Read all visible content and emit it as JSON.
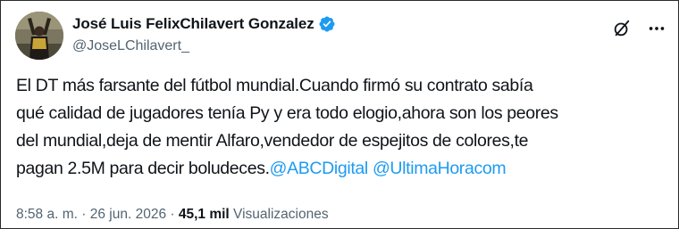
{
  "author": {
    "display_name": "José Luis FelixChilavert Gonzalez",
    "handle": "@JoseLChilavert_",
    "verified": true,
    "avatar_icon": "player-photo-avatar"
  },
  "header_actions": {
    "grok_icon": "grok-slash-circle-icon",
    "more_icon": "more-horizontal-icon"
  },
  "tweet": {
    "lines": [
      "El DT más farsante del fútbol mundial.Cuando firmó su contrato sabía",
      "qué calidad de jugadores tenía Py y era todo elogio,ahora son los peores",
      "del mundial,deja de mentir Alfaro,vendedor de espejitos de colores,te",
      "pagan 2.5M para decir boludeces."
    ],
    "mentions": [
      "@ABCDigital",
      "@UltimaHoracom"
    ]
  },
  "meta": {
    "time": "8:58 a. m.",
    "separator": "·",
    "date": "26 jun. 2026",
    "views_count": "45,1 mil",
    "views_label": "Visualizaciones"
  },
  "colors": {
    "text": "#0f1419",
    "secondary": "#536471",
    "accent": "#1d9bf0"
  }
}
